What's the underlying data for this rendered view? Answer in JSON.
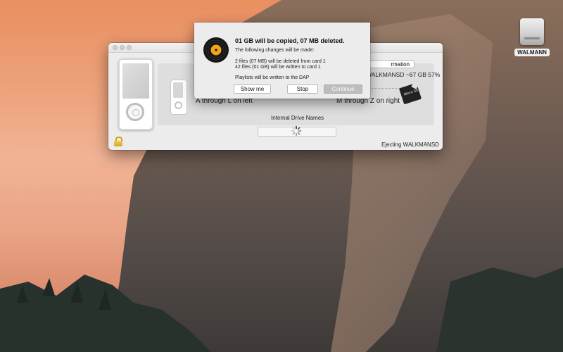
{
  "desktop": {
    "drive_icon_label": "WALMANN"
  },
  "window": {
    "info_button_label": "rmation",
    "drive_info": "WALKMANSD ~67 GB 57%",
    "left_label": "A through L on left",
    "right_label": "M through Z on right",
    "drive_names_label": "Internal Drive Names",
    "status_text": "Ejecting WALKMANSD"
  },
  "dialog": {
    "title": "01 GB will be copied, 07 MB deleted.",
    "subtitle": "The following changes will be made:",
    "line1": "2 files (07 MB) will be deleted from card 1",
    "line2": "42 files (01 GB) will be written to card 1",
    "line3": "Playlists will be written to the DAP",
    "buttons": {
      "show_me": "Show me",
      "stop": "Stop",
      "continue": "Continue"
    }
  },
  "sd_card_text": "Micro SD",
  "colors": {
    "vinyl_label": "#f4a21b",
    "lock": "#e0b12a"
  }
}
